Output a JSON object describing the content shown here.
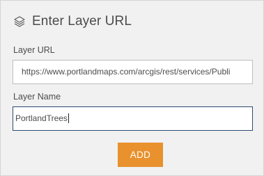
{
  "header": {
    "title": "Enter Layer URL",
    "icon": "layers-icon"
  },
  "form": {
    "url_label": "Layer URL",
    "url_value": "https://www.portlandmaps.com/arcgis/rest/services/Publi",
    "name_label": "Layer Name",
    "name_value": "PortlandTrees"
  },
  "actions": {
    "add_label": "ADD"
  },
  "colors": {
    "panel_background": "#f1f1f1",
    "accent_button": "#e8912d",
    "focused_border": "#2b4a72",
    "text": "#4c4c4c"
  }
}
